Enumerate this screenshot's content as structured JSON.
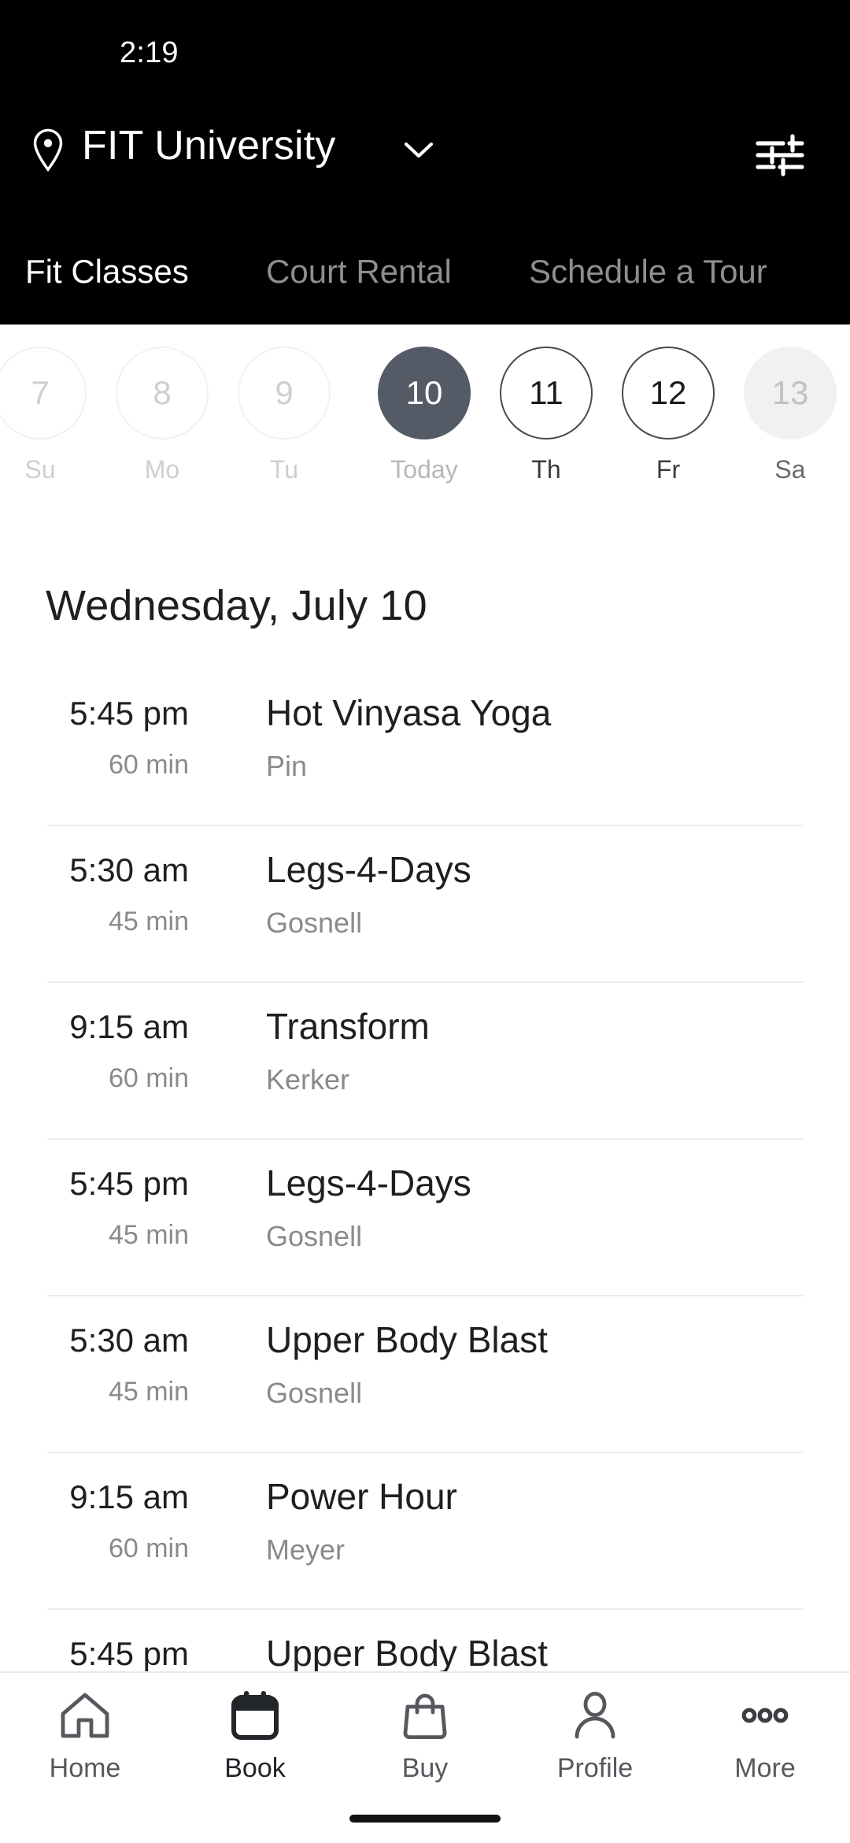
{
  "status_bar": {
    "time": "2:19"
  },
  "header": {
    "location_name": "FIT University",
    "location_icon": "map-pin-icon",
    "chevron_icon": "chevron-down-icon",
    "filter_icon": "filter-sliders-icon",
    "tabs": [
      {
        "label": "Fit Classes",
        "active": true
      },
      {
        "label": "Court Rental",
        "active": false
      },
      {
        "label": "Schedule a Tour",
        "active": false
      }
    ]
  },
  "date_strip": {
    "days": [
      {
        "num": "7",
        "dow": "Su",
        "state": "past"
      },
      {
        "num": "8",
        "dow": "Mo",
        "state": "past"
      },
      {
        "num": "9",
        "dow": "Tu",
        "state": "past"
      },
      {
        "num": "10",
        "dow": "Today",
        "state": "today"
      },
      {
        "num": "11",
        "dow": "Th",
        "state": "avail"
      },
      {
        "num": "12",
        "dow": "Fr",
        "state": "avail"
      },
      {
        "num": "13",
        "dow": "Sa",
        "state": "soft"
      }
    ]
  },
  "day_heading": "Wednesday, July 10",
  "classes": [
    {
      "time": "5:45 pm",
      "duration": "60 min",
      "title": "Hot Vinyasa Yoga",
      "instructor": "Pin"
    },
    {
      "time": "5:30 am",
      "duration": "45 min",
      "title": "Legs-4-Days",
      "instructor": "Gosnell"
    },
    {
      "time": "9:15 am",
      "duration": "60 min",
      "title": "Transform",
      "instructor": "Kerker"
    },
    {
      "time": "5:45 pm",
      "duration": "45 min",
      "title": "Legs-4-Days",
      "instructor": "Gosnell"
    },
    {
      "time": "5:30 am",
      "duration": "45 min",
      "title": "Upper Body Blast",
      "instructor": "Gosnell"
    },
    {
      "time": "9:15 am",
      "duration": "60 min",
      "title": "Power Hour",
      "instructor": "Meyer"
    },
    {
      "time": "5:45 pm",
      "duration": "",
      "title": "Upper Body Blast",
      "instructor": ""
    }
  ],
  "bottom_nav": {
    "items": [
      {
        "label": "Home",
        "icon": "home-icon",
        "active": false
      },
      {
        "label": "Book",
        "icon": "calendar-icon",
        "active": true
      },
      {
        "label": "Buy",
        "icon": "shopping-bag-icon",
        "active": false
      },
      {
        "label": "Profile",
        "icon": "person-icon",
        "active": false
      },
      {
        "label": "More",
        "icon": "ellipsis-icon",
        "active": false
      }
    ]
  },
  "colors": {
    "header_bg": "#000000",
    "today_pill": "#555b66",
    "accent_text": "#1f1f1f",
    "muted_text": "#8a8a8a"
  }
}
